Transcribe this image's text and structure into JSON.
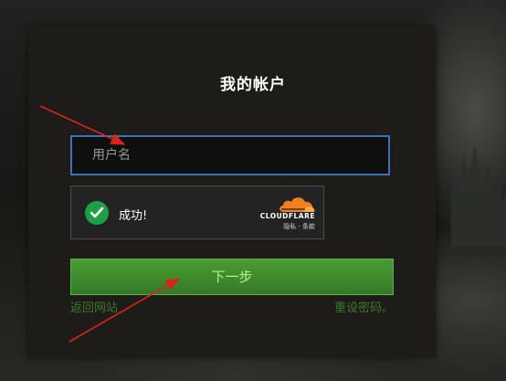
{
  "login": {
    "title": "我的帐户",
    "username_placeholder": "用户名",
    "username_value": "",
    "captcha": {
      "status_text": "成功!",
      "status_icon": "check-circle-icon",
      "brand": "CLOUDFLARE",
      "privacy_label": "隐私",
      "separator": "·",
      "terms_label": "条款"
    },
    "next_button_label": "下一步",
    "back_link_label": "返回网站",
    "reset_link_label": "重设密码。"
  },
  "colors": {
    "accent_blue": "#3a74b8",
    "button_green": "#3e8a2c",
    "link_green": "#3b7a2a",
    "annotation_red": "#d9241c",
    "success_green": "#1f9e45",
    "cloudflare_orange": "#f38020"
  }
}
